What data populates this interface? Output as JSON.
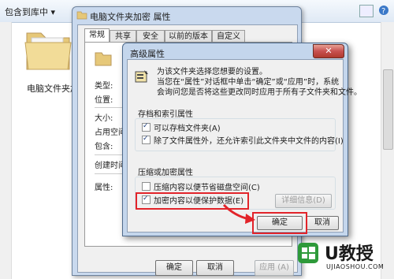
{
  "explorer": {
    "toolbar_item": "包含到库中 ▾",
    "folder_label": "电脑文件夹加密"
  },
  "properties_dialog": {
    "title": "电脑文件夹加密 属性",
    "tabs": [
      {
        "label": "常规",
        "active": true
      },
      {
        "label": "共享",
        "active": false
      },
      {
        "label": "安全",
        "active": false
      },
      {
        "label": "以前的版本",
        "active": false
      },
      {
        "label": "自定义",
        "active": false
      }
    ],
    "labels": [
      "类型:",
      "位置:",
      "大小:",
      "占用空间",
      "包含:",
      "创建时间",
      "属性:"
    ],
    "buttons": {
      "ok": "确定",
      "cancel": "取消",
      "apply": "应用 (A)"
    }
  },
  "advanced_dialog": {
    "title": "高级属性",
    "close": "✕",
    "description_line1": "为该文件夹选择您想要的设置。",
    "description_line2": "当您在“属性”对话框中单击“确定”或“应用”时，系统",
    "description_line3": "会询问您是否将这些更改同时应用于所有子文件夹和文件。",
    "archive_group": {
      "title": "存档和索引属性",
      "options": [
        {
          "label": "可以存档文件夹(A)",
          "checked": true
        },
        {
          "label": "除了文件属性外，还允许索引此文件夹中文件的内容(I)",
          "checked": true
        }
      ]
    },
    "compress_group": {
      "title": "压缩或加密属性",
      "options": [
        {
          "label": "压缩内容以便节省磁盘空间(C)",
          "checked": false
        },
        {
          "label": "加密内容以便保护数据(E)",
          "checked": true
        }
      ],
      "details_button": "详细信息(D)"
    },
    "buttons": {
      "ok": "确定",
      "cancel": "取消"
    }
  },
  "watermark": {
    "brand": "U教授",
    "url": "UJIAOSHOU.COM"
  },
  "colors": {
    "highlight": "#e2242a",
    "title_bar": "#c4d6ec"
  }
}
